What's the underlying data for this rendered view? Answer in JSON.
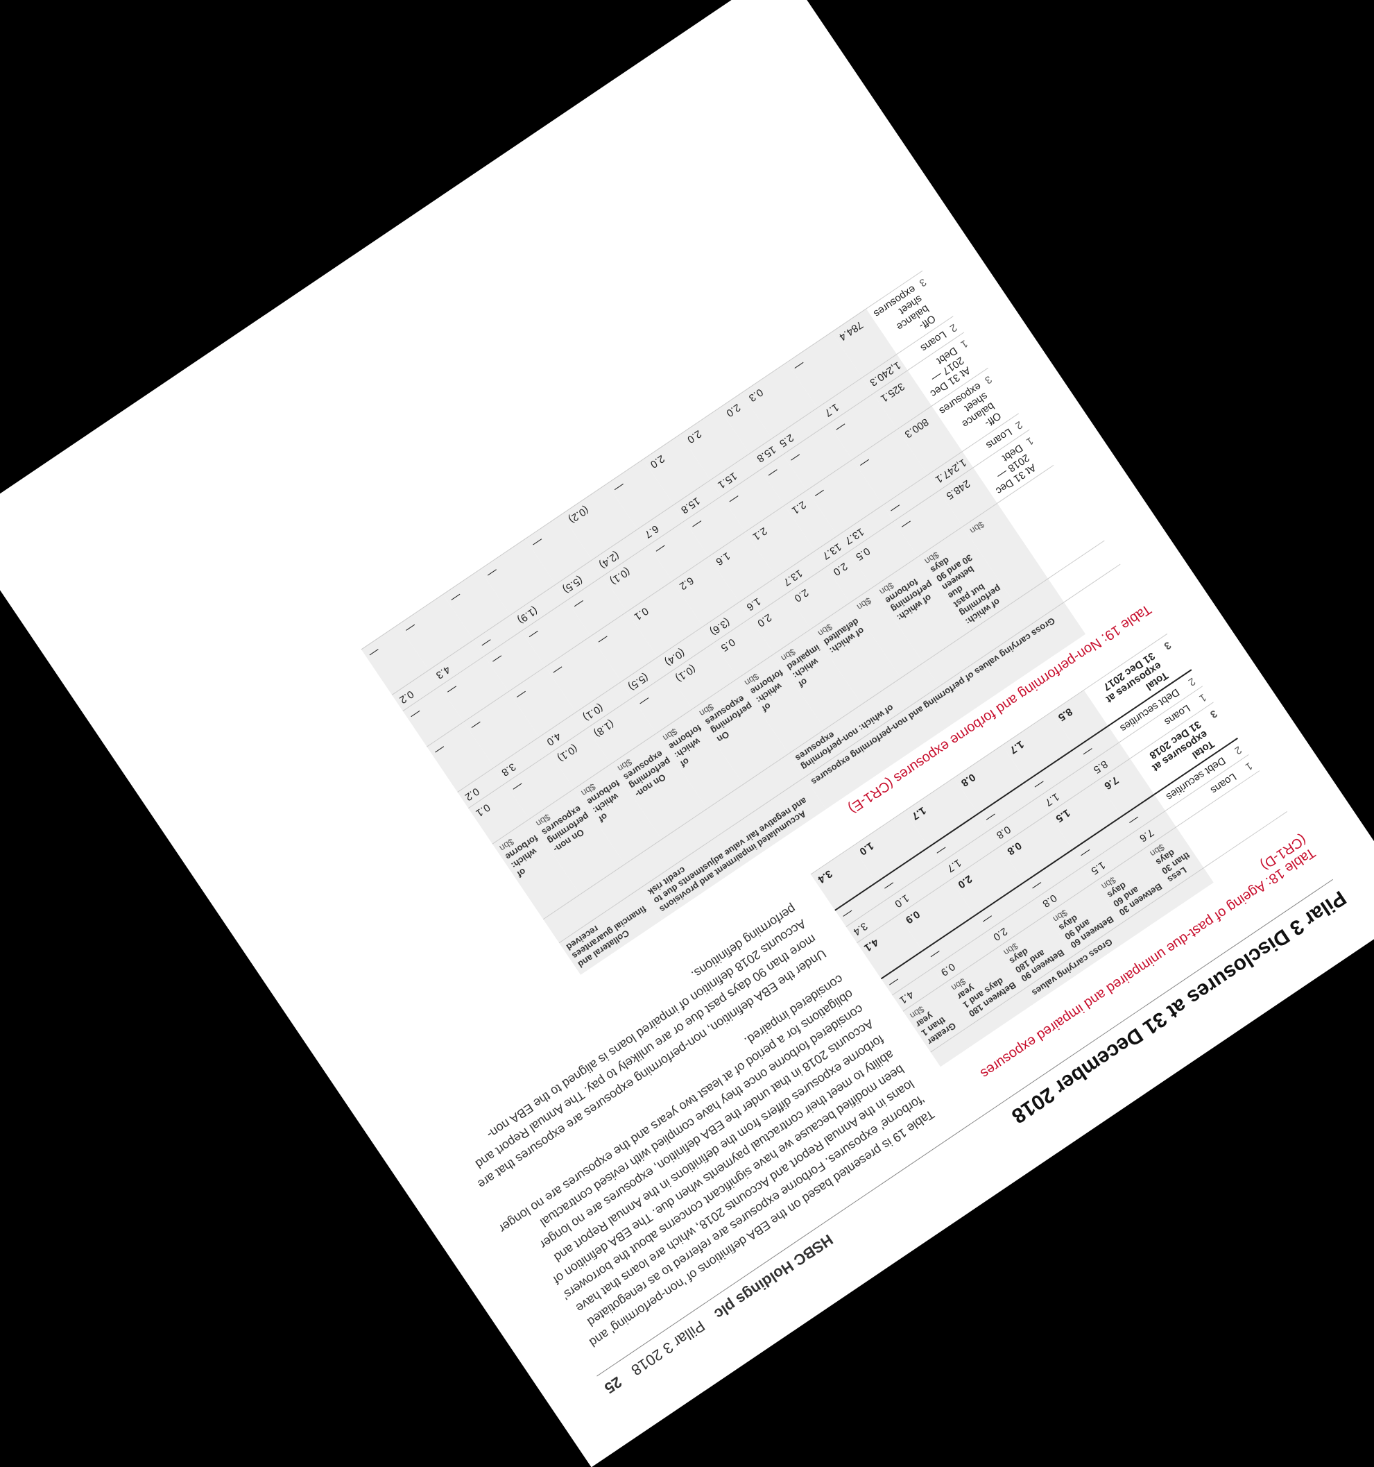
{
  "header": {
    "doc_title": "Pilar 3 Disclosures at 31 December 2018",
    "company": "HSBC Holdings plc",
    "report": "Pillar 3 2018",
    "page_number": "25"
  },
  "table18": {
    "title": "Table 18: Ageing of past-due unimpaired and impaired exposures (CR1-D)",
    "group_header": "Gross carrying values",
    "columns": [
      "Less than 30 days",
      "Between 30 and 60 days",
      "Between 60 and 90 days",
      "Between 90 and 180 days",
      "Between 180 days and 1 year",
      "Greater than 1 year"
    ],
    "unit": "$bn",
    "rows": [
      {
        "n": "1",
        "label": "Loans",
        "values": [
          "7.6",
          "1.5",
          "0.8",
          "2.0",
          "0.9",
          "4.1"
        ]
      },
      {
        "n": "2",
        "label": "Debt securities",
        "values": [
          "—",
          "—",
          "—",
          "—",
          "—",
          "—"
        ]
      },
      {
        "n": "3",
        "label": "Total exposures at 31 Dec 2018",
        "values": [
          "7.6",
          "1.5",
          "0.8",
          "2.0",
          "0.9",
          "4.1"
        ]
      },
      {
        "n": "1",
        "label": "Loans",
        "values": [
          "8.5",
          "1.7",
          "0.8",
          "1.7",
          "1.0",
          "3.4"
        ]
      },
      {
        "n": "2",
        "label": "Debt securities",
        "values": [
          "—",
          "—",
          "—",
          "—",
          "—",
          "—"
        ]
      },
      {
        "n": "3",
        "label": "Total exposures at 31 Dec 2017",
        "values": [
          "8.5",
          "1.7",
          "0.8",
          "1.7",
          "1.0",
          "3.4"
        ]
      }
    ]
  },
  "table19": {
    "title": "Table 19: Non-performing and forborne exposures (CR1-E)",
    "group_header": "Gross carrying values of performing and non-performing exposures",
    "sub_header_np": "of which: non-performing exposures",
    "impairment_header": "Accumulated impairment and provisions and negative fair value adjustments due to credit risk",
    "collateral_header": "Collateral and financial guarantees received",
    "columns": [
      "",
      "of which: performing but past due between 30 and 90 days",
      "of which: performing forborne",
      "",
      "of which: defaulted",
      "of which: impaired",
      "of which: forborne",
      "On performing exposures",
      "of which: forborne",
      "On non-performing exposures",
      "of which: forborne",
      "On non-performing exposures",
      "of which: forborne"
    ],
    "unit": "$bn",
    "rows": [
      {
        "n": "1",
        "label": "At 31 Dec 2018 — Debt",
        "values": [
          "248.5",
          "—",
          "0.5",
          "2.0",
          "2.0",
          "2.0",
          "0.5",
          "(0.1)",
          "—",
          "(1.8)",
          "(0.1)",
          "—",
          "0.1"
        ]
      },
      {
        "n": "2",
        "label": "Loans",
        "values": [
          "1,247.1",
          "—",
          "13.7",
          "13.7",
          "13.7",
          "1.6",
          "(3.6)",
          "(0.4)",
          "(5.5)",
          "(0.1)",
          "4.0",
          "3.8",
          "0.2"
        ]
      },
      {
        "n": "3",
        "label": "Off-balance sheet exposures",
        "values": [
          "800.3",
          "—",
          "—",
          "2.1",
          "2.1",
          "1.6",
          "6.2",
          "0.1",
          "—",
          "—",
          "—",
          "—",
          "—"
        ]
      },
      {
        "n": "1",
        "label": "At 31 Dec 2017 — Debt",
        "values": [
          "325.1",
          "—",
          "—",
          "—",
          "—",
          "—",
          "—",
          "(0.1)",
          "—",
          "—",
          "—",
          "—",
          "—"
        ]
      },
      {
        "n": "2",
        "label": "Loans",
        "values": [
          "1,240.3",
          "1.7",
          "2.5",
          "15.8",
          "15.1",
          "15.8",
          "6.7",
          "(2.4)",
          "(5.5)",
          "(1.9)",
          "—",
          "4.3",
          "0.2"
        ]
      },
      {
        "n": "3",
        "label": "Off-balance sheet exposures",
        "values": [
          "784.4",
          "—",
          "0.3",
          "2.0",
          "2.0",
          "2.0",
          "—",
          "(0.2)",
          "—",
          "—",
          "—",
          "—",
          "—"
        ]
      }
    ]
  },
  "body_paragraphs": [
    "Table 19 is presented based on the EBA definitions of 'non-performing' and 'forborne' exposures. Forborne exposures are referred to as renegotiated loans in the Annual Report and Accounts 2018, which are loans that have been modified because we have significant concerns about the borrowers' ability to meet their contractual payments when due. The EBA definition of forborne exposures differs from the definitions in the Annual Report and Accounts 2018 in that under the EBA definition, exposures are no longer considered forborne once they have complied with revised contractual obligations for a period of at least two years and the exposures are no longer considered impaired.",
    "Under the EBA definition, non-performing exposures are exposures that are more than 90 days past due or are unlikely to pay. The Annual Report and Accounts 2018 definition of impaired loans is aligned to the EBA non-performing definitions."
  ]
}
